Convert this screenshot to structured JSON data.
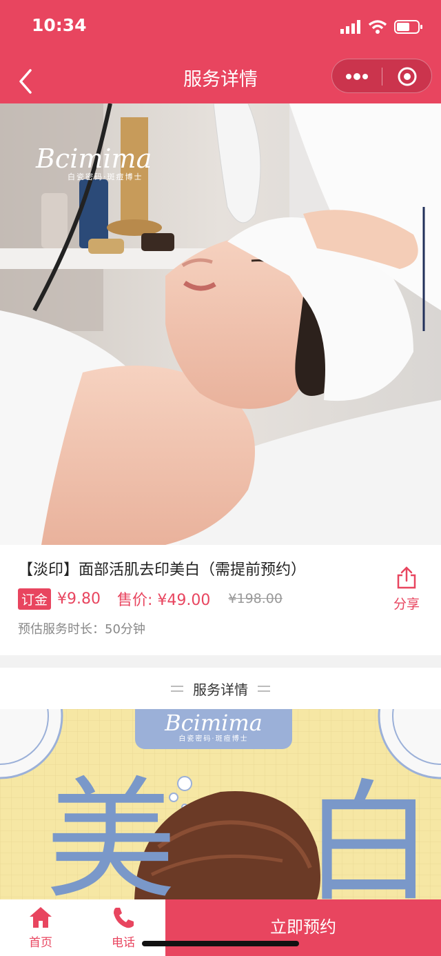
{
  "status_bar": {
    "time": "10:34"
  },
  "nav": {
    "title": "服务详情"
  },
  "hero": {
    "brand_script": "Bcimima",
    "brand_sub": "白瓷密码·斑痘博士"
  },
  "product": {
    "name": "【淡印】面部活肌去印美白（需提前预约）",
    "deposit_tag": "订金",
    "deposit_value": "¥9.80",
    "sale_price": "售价: ¥49.00",
    "original_price": "¥198.00",
    "duration": "预估服务时长：50分钟",
    "share_label": "分享"
  },
  "details_section": {
    "label": "服务详情"
  },
  "poster": {
    "brand_script": "Bcimima",
    "brand_sub": "白瓷密码·斑痘博士",
    "char_left": "美",
    "char_right": "白"
  },
  "tabbar": {
    "home_label": "首页",
    "phone_label": "电话",
    "book_label": "立即预约"
  },
  "colors": {
    "brand": "#e8455f",
    "poster_bg": "#f6e7a4",
    "poster_text": "#7a98c9"
  }
}
